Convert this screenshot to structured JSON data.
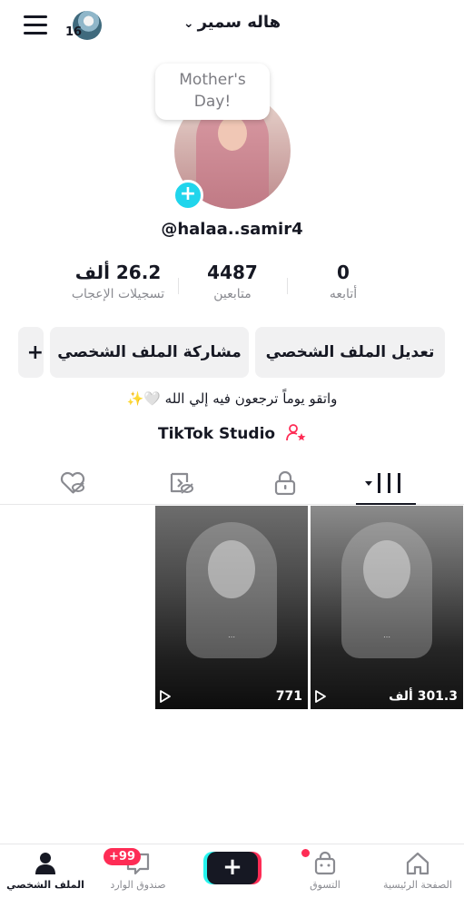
{
  "header": {
    "story_count": "16",
    "username": "هاله سمير"
  },
  "profile": {
    "note_bubble_line1": "Mother's",
    "note_bubble_line2": "Day!",
    "handle": "@halaa..samir4",
    "bio": "واتقو يوماً ترجعون فيه إلي الله 🤍✨",
    "studio_label": "TikTok Studio"
  },
  "stats": {
    "following": {
      "value": "0",
      "label": "أتابعه"
    },
    "followers": {
      "value": "4487",
      "label": "متابعين"
    },
    "likes": {
      "value": "26.2 ألف",
      "label": "تسجيلات الإعجاب"
    }
  },
  "actions": {
    "edit_profile": "تعديل الملف الشخصي",
    "share_profile": "مشاركة الملف الشخصي",
    "add_friend": "+"
  },
  "videos": [
    {
      "views": "301.3 ألف"
    },
    {
      "views": "771"
    }
  ],
  "bottom_nav": {
    "home": "الصفحة الرئيسية",
    "shop": "التسوق",
    "create": "+",
    "inbox": "صندوق الوارد",
    "inbox_badge": "+99",
    "profile": "الملف الشخصي"
  },
  "colors": {
    "accent_red": "#fe2c55",
    "accent_cyan": "#25f4ee",
    "add_button": "#20d5ec"
  },
  "icons": {
    "menu": "hamburger-icon",
    "videos_tab": "grid-icon",
    "private_tab": "lock-icon",
    "reposts_tab": "repost-icon",
    "liked_tab": "heart-hidden-icon"
  }
}
